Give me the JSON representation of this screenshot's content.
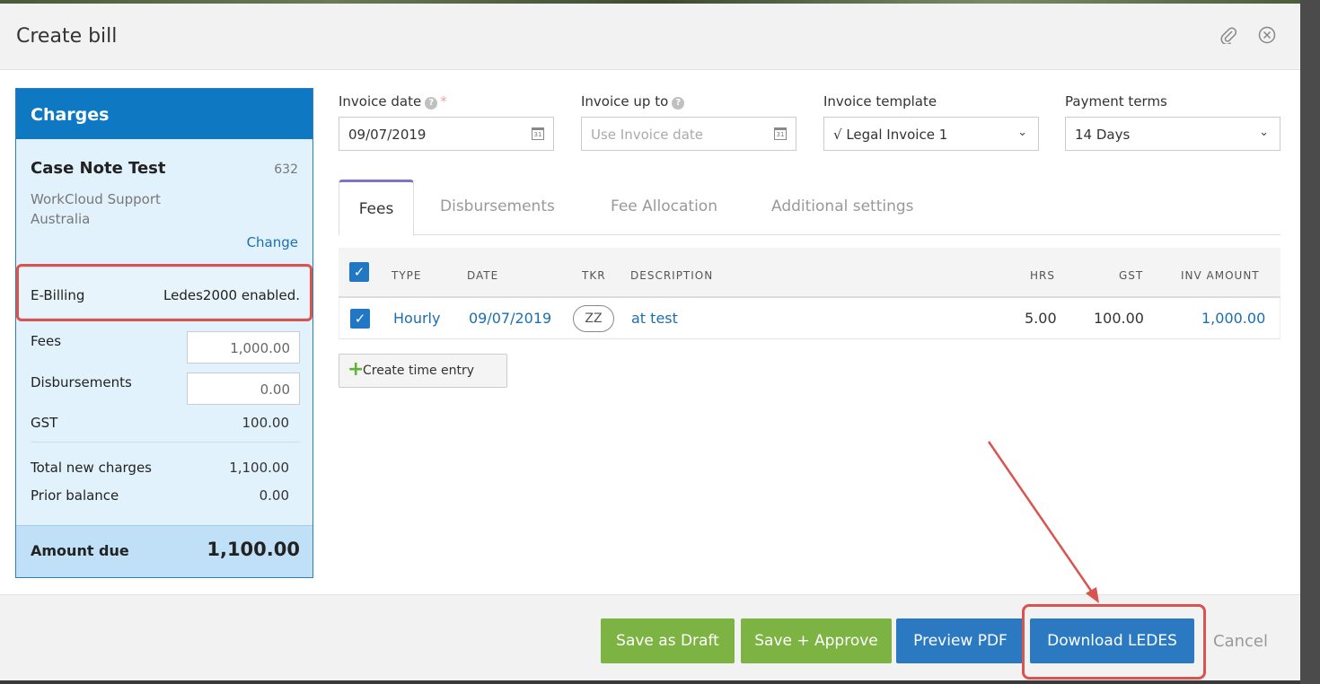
{
  "modal": {
    "title": "Create bill",
    "attach_icon": "paperclip-icon",
    "close_icon": "close-circle-icon"
  },
  "charges": {
    "heading": "Charges",
    "case_name": "Case Note Test",
    "case_number": "632",
    "client": "WorkCloud Support Australia",
    "change_label": "Change",
    "ebilling_label": "E-Billing",
    "ebilling_value": "Ledes2000 enabled.",
    "fees_label": "Fees",
    "fees_value": "1,000.00",
    "disbursements_label": "Disbursements",
    "disbursements_value": "0.00",
    "gst_label": "GST",
    "gst_value": "100.00",
    "total_new_label": "Total new charges",
    "total_new_value": "1,100.00",
    "prior_label": "Prior balance",
    "prior_value": "0.00",
    "amount_due_label": "Amount due",
    "amount_due_value": "1,100.00"
  },
  "form": {
    "invoice_date_label": "Invoice date",
    "invoice_date_value": "09/07/2019",
    "invoice_upto_label": "Invoice up to",
    "invoice_upto_placeholder": "Use Invoice date",
    "template_label": "Invoice template",
    "template_value": "√ Legal Invoice 1",
    "terms_label": "Payment terms",
    "terms_value": "14 Days"
  },
  "tabs": [
    "Fees",
    "Disbursements",
    "Fee Allocation",
    "Additional settings"
  ],
  "table": {
    "headers": {
      "type": "TYPE",
      "date": "DATE",
      "tkr": "TKR",
      "description": "DESCRIPTION",
      "hrs": "HRS",
      "gst": "GST",
      "amount": "INV AMOUNT"
    },
    "rows": [
      {
        "type": "Hourly",
        "date": "09/07/2019",
        "tkr": "ZZ",
        "description": "at test",
        "hrs": "5.00",
        "gst": "100.00",
        "amount": "1,000.00"
      }
    ]
  },
  "create_time_entry": "Create time entry",
  "footer": {
    "save_draft": "Save as Draft",
    "save_approve": "Save + Approve",
    "preview_pdf": "Preview PDF",
    "download_ledes": "Download LEDES",
    "cancel": "Cancel"
  },
  "colors": {
    "accent_blue": "#0f78c2",
    "green_button": "#7cb342",
    "blue_button": "#2b7ac1",
    "annotation_red": "#d9534f"
  }
}
